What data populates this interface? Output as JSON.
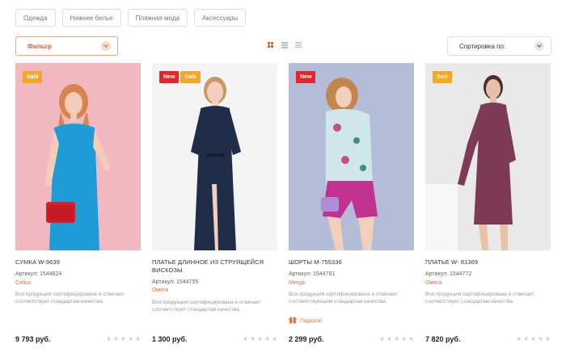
{
  "categories": [
    "Одежда",
    "Нижнее белье",
    "Пляжная мода",
    "Аксессуары"
  ],
  "toolbar": {
    "filter_label": "Фильтр",
    "sort_label": "Сортировка по:"
  },
  "products": [
    {
      "badges": [
        "Sale"
      ],
      "title": "СУМКА W-9639",
      "sku": "Артикул: 1544824",
      "brand": "Celius",
      "description": "Вся продукция сертифицирована и отвечает соответствует стандартам качества.",
      "gift": "",
      "price": "9 793 руб.",
      "rating": 0
    },
    {
      "badges": [
        "New",
        "Sale"
      ],
      "title": "ПЛАТЬЕ ДЛИННОЕ ИЗ СТРУЯЩЕЙСЯ ВИСКОЗЫ",
      "sku": "Артикул: 1544755",
      "brand": "Омега",
      "description": "Вся продукция сертифицирована и отвечает соответствует стандартам качества.",
      "gift": "",
      "price": "1 300 руб.",
      "rating": 0
    },
    {
      "badges": [
        "New"
      ],
      "title": "ШОРТЫ М-755336",
      "sku": "Артикул: 1544781",
      "brand": "Merga",
      "description": "Вся продукция сертифицирована и отвечает соответствующим стандартам качества.",
      "gift": "Подарок!",
      "price": "2 299 руб.",
      "rating": 0
    },
    {
      "badges": [
        "Sale"
      ],
      "title": "ПЛАТЬЕ W- 81369",
      "sku": "Артикул: 1544772",
      "brand": "Омега",
      "description": "Вся продукция сертифицирована и отвечает соответствует стандартам качества.",
      "gift": "",
      "price": "7 820 руб.",
      "rating": 0
    }
  ],
  "colors": {
    "accent": "#ec5a2a",
    "badge_new": "#e8232a",
    "badge_sale": "#f5a623"
  }
}
